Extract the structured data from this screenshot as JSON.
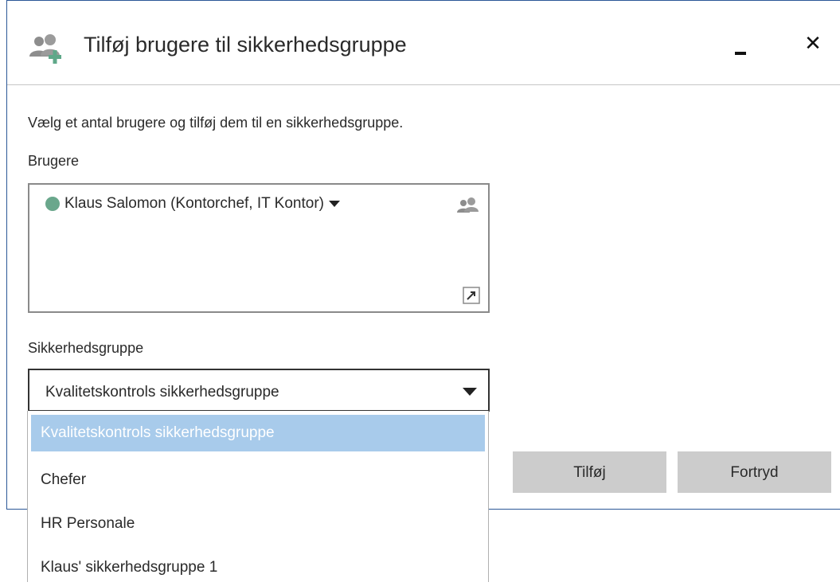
{
  "dialog": {
    "title": "Tilføj brugere til sikkerhedsgruppe",
    "title_icon": "users-add-icon",
    "minimize_icon": "minimize-icon",
    "close_label": "✕",
    "description": "Vælg et antal brugere og tilføj dem til en sikkerhedsgruppe."
  },
  "users": {
    "label": "Brugere",
    "selected": [
      {
        "name": "Klaus Salomon (Kontorchef, IT Kontor)",
        "status_color": "#6aa78c"
      }
    ],
    "picker_icon": "users-icon",
    "expand_icon": "expand-icon"
  },
  "security_group": {
    "label": "Sikkerhedsgruppe",
    "value": "Kvalitetskontrols sikkerhedsgruppe",
    "options": [
      "Kvalitetskontrols sikkerhedsgruppe",
      "Chefer",
      "HR Personale",
      "Klaus' sikkerhedsgruppe 1"
    ],
    "highlighted_option": "Kvalitetskontrols sikkerhedsgruppe"
  },
  "buttons": {
    "add": "Tilføj",
    "cancel": "Fortryd"
  },
  "colors": {
    "accent": "#2b5797",
    "highlight": "#a8cbeb",
    "button_bg": "#cccccc",
    "status_online": "#6aa78c"
  }
}
